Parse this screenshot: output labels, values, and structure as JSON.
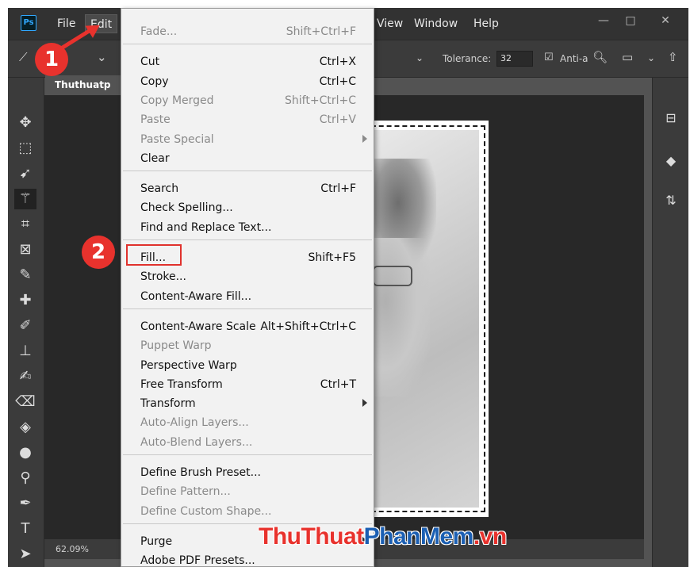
{
  "app": {
    "logo": "Ps",
    "menu": [
      "File",
      "Edit",
      "View",
      "Window",
      "Help"
    ],
    "window_controls": [
      "—",
      "□",
      "✕"
    ]
  },
  "options_bar": {
    "tolerance_label": "Tolerance:",
    "tolerance_value": "32",
    "antialias_label": "Anti-a"
  },
  "document": {
    "tab_title": "Thuthuatp",
    "zoom": "62.09%"
  },
  "edit_menu": {
    "groups": [
      [
        {
          "label": "Fade...",
          "shortcut": "Shift+Ctrl+F",
          "disabled": true
        }
      ],
      [
        {
          "label": "Cut",
          "shortcut": "Ctrl+X"
        },
        {
          "label": "Copy",
          "shortcut": "Ctrl+C"
        },
        {
          "label": "Copy Merged",
          "shortcut": "Shift+Ctrl+C",
          "disabled": true
        },
        {
          "label": "Paste",
          "shortcut": "Ctrl+V",
          "disabled": true
        },
        {
          "label": "Paste Special",
          "submenu": true,
          "disabled": true
        },
        {
          "label": "Clear"
        }
      ],
      [
        {
          "label": "Search",
          "shortcut": "Ctrl+F"
        },
        {
          "label": "Check Spelling..."
        },
        {
          "label": "Find and Replace Text..."
        }
      ],
      [
        {
          "label": "Fill...",
          "shortcut": "Shift+F5",
          "highlighted": true
        },
        {
          "label": "Stroke..."
        },
        {
          "label": "Content-Aware Fill..."
        }
      ],
      [
        {
          "label": "Content-Aware Scale",
          "shortcut": "Alt+Shift+Ctrl+C"
        },
        {
          "label": "Puppet Warp",
          "disabled": true
        },
        {
          "label": "Perspective Warp"
        },
        {
          "label": "Free Transform",
          "shortcut": "Ctrl+T"
        },
        {
          "label": "Transform",
          "submenu": true
        },
        {
          "label": "Auto-Align Layers...",
          "disabled": true
        },
        {
          "label": "Auto-Blend Layers...",
          "disabled": true
        }
      ],
      [
        {
          "label": "Define Brush Preset..."
        },
        {
          "label": "Define Pattern...",
          "disabled": true
        },
        {
          "label": "Define Custom Shape...",
          "disabled": true
        }
      ],
      [
        {
          "label": "Purge",
          "submenu": true
        },
        {
          "label": "Adobe PDF Presets..."
        }
      ]
    ]
  },
  "callouts": [
    "1",
    "2"
  ],
  "watermark": {
    "part1": "ThuThuat",
    "part2": "PhanMem",
    "part3": ".vn"
  },
  "colors": {
    "callout": "#e8322d",
    "watermark_red": "#e8322d",
    "watermark_blue": "#1b5fb3",
    "menu_bg": "#f2f2f2"
  }
}
